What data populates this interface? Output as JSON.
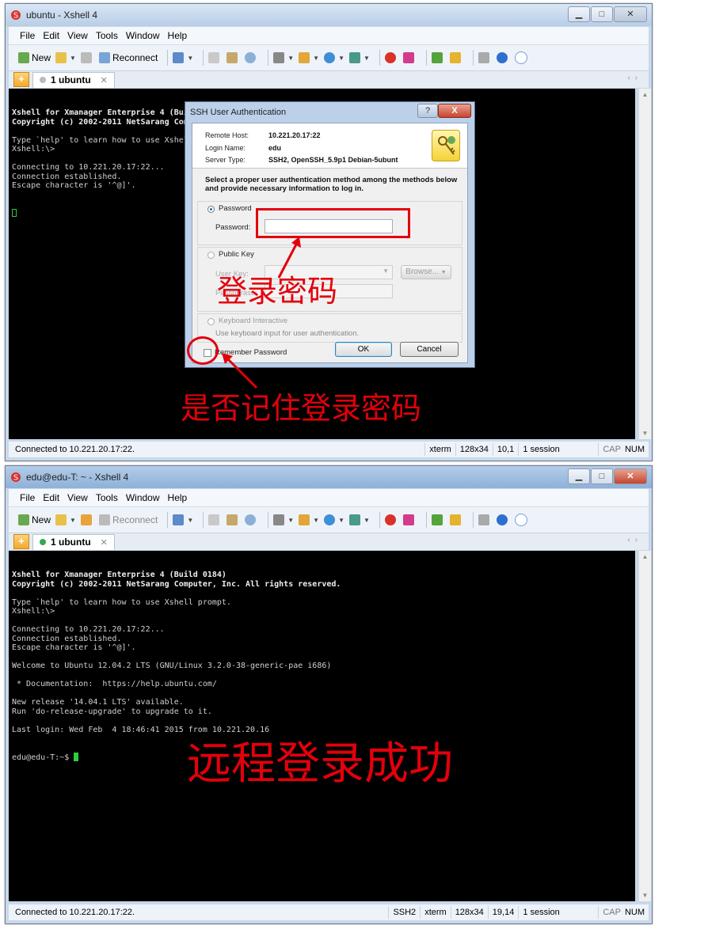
{
  "window1": {
    "title": "ubuntu - Xshell 4",
    "menu": [
      "File",
      "Edit",
      "View",
      "Tools",
      "Window",
      "Help"
    ],
    "toolbar": {
      "new_label": "New",
      "reconnect_label": "Reconnect"
    },
    "tab_label": "1 ubuntu",
    "terminal_lines": [
      "Xshell for Xmanager Enterprise 4 (Build 0184)",
      "Copyright (c) 2002-2011 NetSarang Computer, Inc. All rights reserved.",
      "",
      "Type `help' to learn how to use Xshell prompt.",
      "Xshell:\\>",
      "",
      "Connecting to 10.221.20.17:22...",
      "Connection established.",
      "Escape character is '^@]'."
    ],
    "status": {
      "left": "Connected to 10.221.20.17:22.",
      "term": "xterm",
      "size": "128x34",
      "pos": "10,1",
      "sessions": "1 session",
      "cap": "CAP",
      "num": "NUM"
    }
  },
  "dialog": {
    "title": "SSH User Authentication",
    "help_label": "?",
    "close_label": "X",
    "remote_host_label": "Remote Host:",
    "remote_host": "10.221.20.17:22",
    "login_name_label": "Login Name:",
    "login_name": "edu",
    "server_type_label": "Server Type:",
    "server_type": "SSH2, OpenSSH_5.9p1 Debian-5ubunt",
    "instruction": "Select a proper user authentication method among the methods below and provide necessary information to log in.",
    "password_option": "Password",
    "password_label": "Password:",
    "password_value": "",
    "public_key_option": "Public Key",
    "user_key_label": "User Key:",
    "browse_label": "Browse...",
    "passphrase_label": "Passphrase:",
    "keyboard_option": "Keyboard Interactive",
    "keyboard_note": "Use keyboard input for user authentication.",
    "remember_label": "Remember Password",
    "ok_label": "OK",
    "cancel_label": "Cancel"
  },
  "annotations": {
    "password_hint": "登录密码",
    "remember_hint": "是否记住登录密码",
    "success": "远程登录成功",
    "color": "#e3000b"
  },
  "window2": {
    "title": "edu@edu-T: ~ - Xshell 4",
    "menu": [
      "File",
      "Edit",
      "View",
      "Tools",
      "Window",
      "Help"
    ],
    "toolbar": {
      "new_label": "New",
      "reconnect_label": "Reconnect"
    },
    "tab_label": "1 ubuntu",
    "terminal_lines": [
      "Xshell for Xmanager Enterprise 4 (Build 0184)",
      "Copyright (c) 2002-2011 NetSarang Computer, Inc. All rights reserved.",
      "",
      "Type `help' to learn how to use Xshell prompt.",
      "Xshell:\\>",
      "",
      "Connecting to 10.221.20.17:22...",
      "Connection established.",
      "Escape character is '^@]'.",
      "",
      "Welcome to Ubuntu 12.04.2 LTS (GNU/Linux 3.2.0-38-generic-pae i686)",
      "",
      " * Documentation:  https://help.ubuntu.com/",
      "",
      "New release '14.04.1 LTS' available.",
      "Run 'do-release-upgrade' to upgrade to it.",
      "",
      "Last login: Wed Feb  4 18:46:41 2015 from 10.221.20.16"
    ],
    "prompt": "edu@edu-T:~$ ",
    "status": {
      "left": "Connected to 10.221.20.17:22.",
      "proto": "SSH2",
      "term": "xterm",
      "size": "128x34",
      "pos": "19,14",
      "sessions": "1 session",
      "cap": "CAP",
      "num": "NUM"
    }
  }
}
